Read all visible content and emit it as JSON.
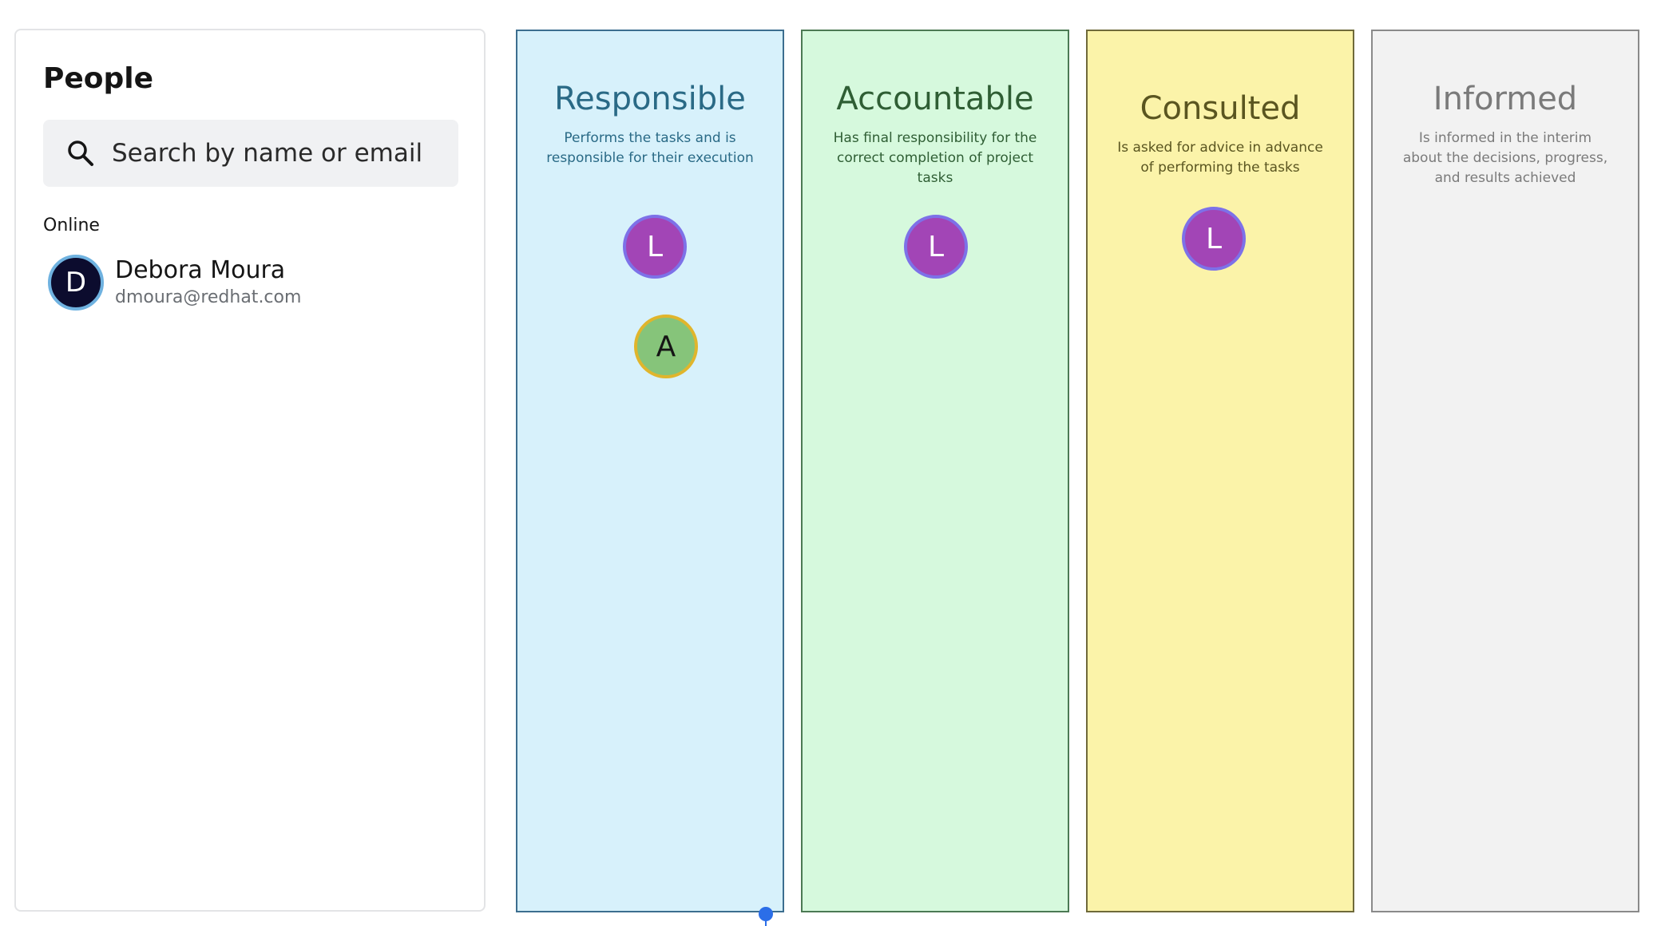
{
  "people_panel": {
    "title": "People",
    "search": {
      "placeholder": "Search by name or email",
      "value": ""
    },
    "section_label": "Online",
    "people": [
      {
        "initial": "D",
        "name": "Debora Moura",
        "email": "dmoura@redhat.com"
      }
    ]
  },
  "columns": [
    {
      "title": "Responsible",
      "description": "Performs the tasks and is responsible for their execution",
      "tokens": [
        "L",
        "A"
      ]
    },
    {
      "title": "Accountable",
      "description": "Has final responsibility for the correct completion of project tasks",
      "tokens": [
        "L"
      ]
    },
    {
      "title": "Consulted",
      "description": "Is asked for advice in advance of performing the tasks",
      "tokens": [
        "L"
      ]
    },
    {
      "title": "Informed",
      "description": "Is informed in the interim about the decisions, progress, and results achieved",
      "tokens": []
    }
  ],
  "colors": {
    "responsible_bg": "#d7f1fb",
    "responsible_border": "#3c6e8f",
    "responsible_text": "#2a6a86",
    "accountable_bg": "#d6f9dd",
    "accountable_border": "#4c7a54",
    "accountable_text": "#2f5e34",
    "consulted_bg": "#fbf3a9",
    "consulted_border": "#6f6a3a",
    "consulted_text": "#5a5520",
    "informed_bg": "#f2f2f2",
    "informed_border": "#8a8a8a",
    "informed_text": "#7a7a7a",
    "token_l": "#a245b6",
    "token_a": "#86c47a",
    "avatar": "#0c0c2e"
  }
}
